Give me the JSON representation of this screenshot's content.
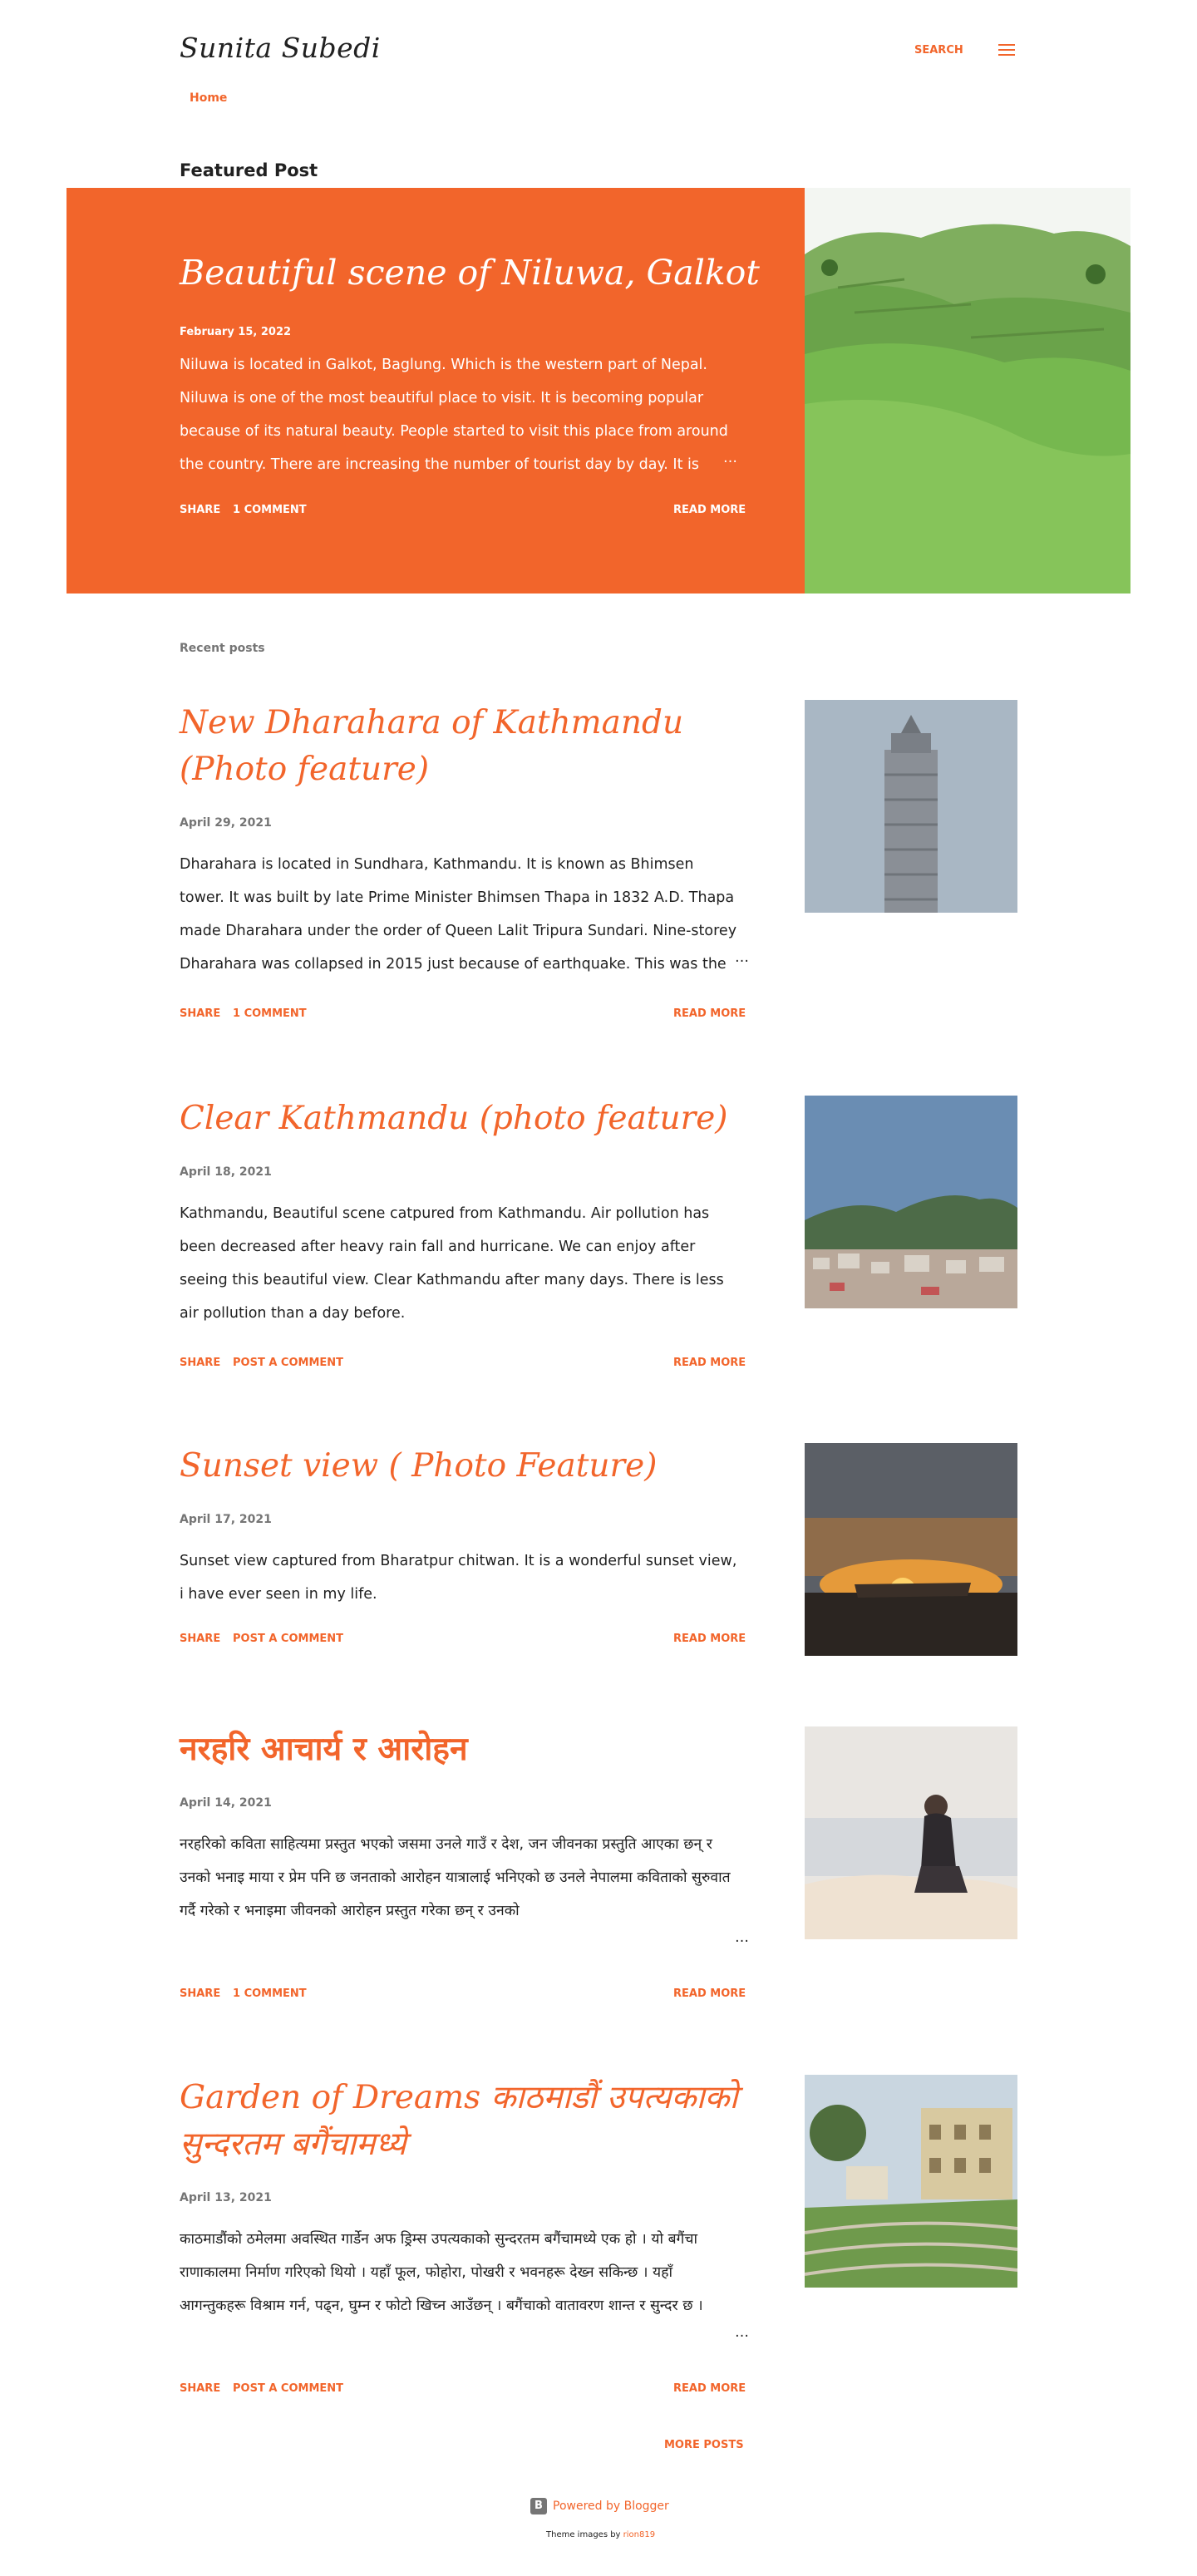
{
  "header": {
    "blog_title": "Sunita Subedi",
    "search_label": "SEARCH",
    "nav_home": "Home"
  },
  "featured": {
    "section_heading": "Featured Post",
    "title": "Beautiful scene of Niluwa, Galkot",
    "date": "February 15, 2022",
    "snippet": " Niluwa is located in Galkot, Baglung. Which is the western part of Nepal. Niluwa is one of the most beautiful place to visit.  It is becoming popular because of its natural beauty. People started to visit this place from around the country. There are increasing the number of tourist day by day.  It is",
    "ellipsis": "…",
    "share_label": "SHARE",
    "comments_label": "1 COMMENT",
    "read_more_label": "READ MORE"
  },
  "recent": {
    "heading": "Recent posts",
    "posts": [
      {
        "title": "New Dharahara of Kathmandu (Photo feature)",
        "date": "April 29, 2021",
        "snippet": "Dharahara is located in Sundhara, Kathmandu. It is known as Bhimsen tower. It was built by late Prime Minister Bhimsen Thapa in 1832 A.D. Thapa made Dharahara under the order of Queen Lalit Tripura Sundari.  Nine-storey Dharahara was collapsed in 2015 just because of earthquake. This was the",
        "ellipsis": "…",
        "share_label": "SHARE",
        "comments_label": "1 COMMENT",
        "read_more_label": "READ MORE"
      },
      {
        "title": "Clear Kathmandu (photo feature)",
        "date": "April 18, 2021",
        "snippet": "Kathmandu, Beautiful scene catpured from Kathmandu. Air pollution has been decreased after heavy rain fall and hurricane. We can enjoy after seeing this beautiful view.  Clear Kathmandu after many days. There is less air pollution than a day before.",
        "ellipsis": "",
        "share_label": "SHARE",
        "comments_label": "POST A COMMENT",
        "read_more_label": "READ MORE"
      },
      {
        "title": "Sunset view ( Photo Feature)",
        "date": "April 17, 2021",
        "snippet": " Sunset view captured from Bharatpur chitwan.  It is a wonderful sunset view, i have ever seen in my life.",
        "ellipsis": "",
        "share_label": "SHARE",
        "comments_label": "POST A COMMENT",
        "read_more_label": "READ MORE"
      },
      {
        "title": "नरहरि आचार्य र आरोहन",
        "date": "April 14, 2021",
        "snippet": "नरहरिको कविता साहित्यमा प्रस्तुत भएको जसमा उनले गाउँ र देश, जन जीवनका प्रस्तुति आएका छन् र उनको भनाइ माया र प्रेम पनि छ जनताको आरोहन यात्रालाई भनिएको छ उनले नेपालमा कविताको सुरुवात गर्दै गरेको र भनाइमा जीवनको आरोहन प्रस्तुत गरेका छन् र उनको",
        "ellipsis": "…",
        "share_label": "SHARE",
        "comments_label": "1 COMMENT",
        "read_more_label": "READ MORE"
      },
      {
        "title": "Garden of Dreams काठमाडौं उपत्यकाको सुन्दरतम बगैंचामध्ये",
        "date": "April 13, 2021",
        "snippet": "काठमाडौंको ठमेलमा अवस्थित गार्डेन अफ ड्रिम्स उपत्यकाको सुन्दरतम बगैंचामध्ये एक हो । यो बगैंचा राणाकालमा निर्माण गरिएको थियो । यहाँ फूल, फोहोरा, पोखरी र भवनहरू देख्न सकिन्छ । यहाँ आगन्तुकहरू विश्राम गर्न, पढ्न, घुम्न र फोटो खिच्न आउँछन् । बगैंचाको वातावरण शान्त र सुन्दर छ ।",
        "ellipsis": "…",
        "share_label": "SHARE",
        "comments_label": "POST A COMMENT",
        "read_more_label": "READ MORE"
      }
    ]
  },
  "footer": {
    "more_posts_label": "MORE POSTS",
    "powered_by": "Powered by Blogger",
    "theme_images_prefix": "Theme images by",
    "theme_images_author": "rion819"
  },
  "colors": {
    "accent": "#f2652b",
    "text": "#212121",
    "muted": "#757575",
    "background": "#ffffff"
  },
  "icons": [
    "menu-icon",
    "blogger-icon"
  ]
}
